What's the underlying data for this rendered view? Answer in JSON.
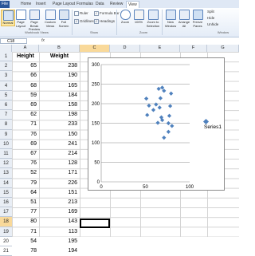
{
  "ribbon": {
    "tabs": [
      "File",
      "Home",
      "Insert",
      "Page Layout",
      "Formulas",
      "Data",
      "Review",
      "View"
    ],
    "buttons": [
      "Normal",
      "Page Layout",
      "Page Break Preview",
      "Custom Views",
      "Full Screen",
      "Zoom",
      "100%",
      "Zoom to Selection",
      "New Window",
      "Arrange All",
      "Freeze Panes"
    ],
    "checks": {
      "ruler": "Ruler",
      "formula_bar": "Formula Bar",
      "gridlines": "Gridlines",
      "headings": "Headings"
    },
    "window_items": [
      "Split",
      "Hide",
      "Unhide"
    ],
    "groups": {
      "workbook_views": "Workbook Views",
      "show": "Show",
      "zoom": "Zoom",
      "window": "Window"
    }
  },
  "formula_bar": {
    "name_box": "C18",
    "fx": "fx",
    "value": ""
  },
  "columns": [
    "A",
    "B",
    "C",
    "D",
    "E",
    "F",
    "G"
  ],
  "rows": [
    "1",
    "2",
    "3",
    "4",
    "5",
    "6",
    "7",
    "8",
    "9",
    "10",
    "11",
    "12",
    "13",
    "14",
    "15",
    "16",
    "17",
    "18",
    "19",
    "20",
    "21"
  ],
  "headers": {
    "a": "Height",
    "b": "Weight"
  },
  "data": [
    [
      65,
      238
    ],
    [
      66,
      190
    ],
    [
      68,
      165
    ],
    [
      59,
      184
    ],
    [
      69,
      158
    ],
    [
      62,
      198
    ],
    [
      71,
      233
    ],
    [
      76,
      150
    ],
    [
      69,
      241
    ],
    [
      67,
      214
    ],
    [
      76,
      128
    ],
    [
      52,
      171
    ],
    [
      79,
      226
    ],
    [
      64,
      151
    ],
    [
      51,
      213
    ],
    [
      77,
      169
    ],
    [
      80,
      143
    ],
    [
      71,
      113
    ],
    [
      54,
      195
    ],
    [
      78,
      194
    ]
  ],
  "chart_data": {
    "type": "scatter",
    "series": [
      {
        "name": "Series1",
        "color": "#4f81bd",
        "points": [
          [
            65,
            238
          ],
          [
            66,
            190
          ],
          [
            68,
            165
          ],
          [
            59,
            184
          ],
          [
            69,
            158
          ],
          [
            62,
            198
          ],
          [
            71,
            233
          ],
          [
            76,
            150
          ],
          [
            69,
            241
          ],
          [
            67,
            214
          ],
          [
            76,
            128
          ],
          [
            52,
            171
          ],
          [
            79,
            226
          ],
          [
            64,
            151
          ],
          [
            51,
            213
          ],
          [
            77,
            169
          ],
          [
            80,
            143
          ],
          [
            71,
            113
          ],
          [
            54,
            195
          ],
          [
            78,
            194
          ]
        ]
      }
    ],
    "xlim": [
      0,
      100
    ],
    "ylim": [
      0,
      300
    ],
    "xticks": [
      0,
      50,
      100
    ],
    "yticks": [
      0,
      50,
      100,
      150,
      200,
      250,
      300
    ],
    "grid": true,
    "legend": "right"
  }
}
